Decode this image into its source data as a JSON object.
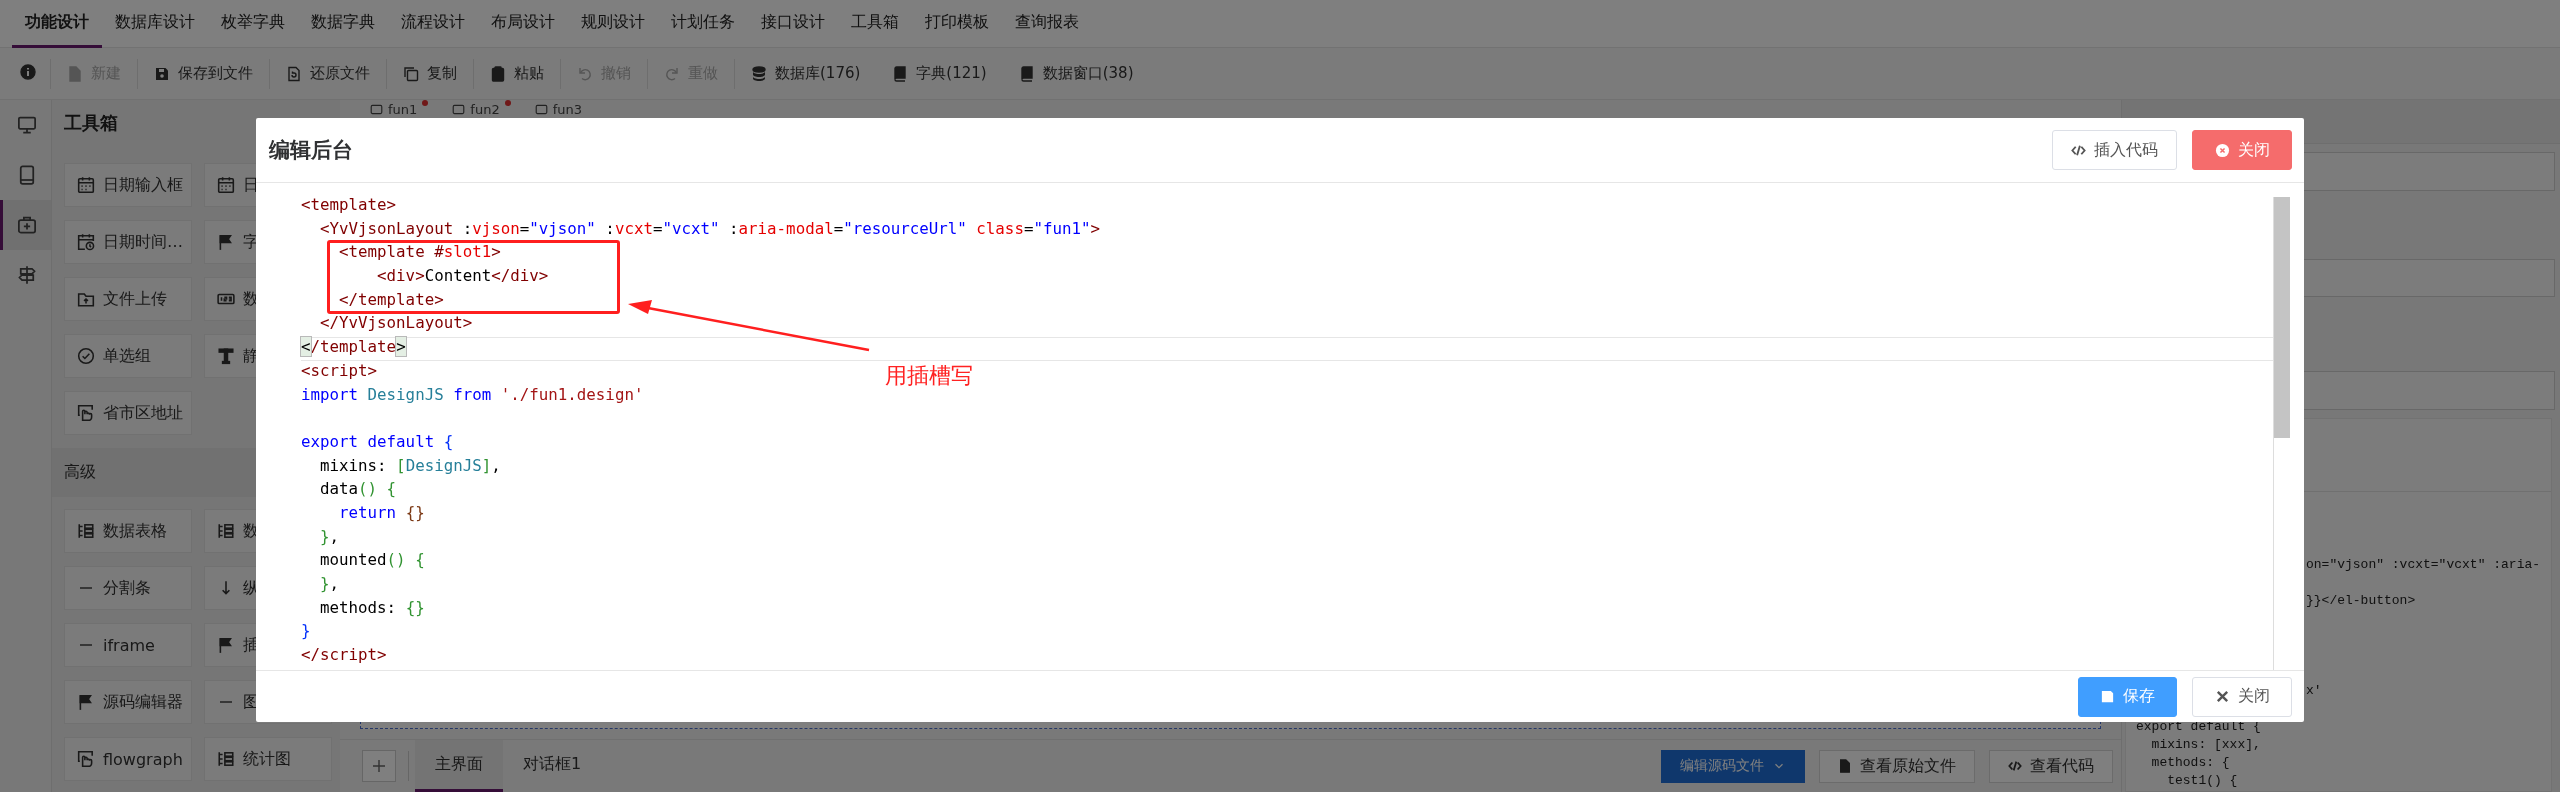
{
  "menu": [
    {
      "label": "功能设计",
      "selected": true
    },
    {
      "label": "数据库设计",
      "selected": false
    },
    {
      "label": "枚举字典",
      "selected": false
    },
    {
      "label": "数据字典",
      "selected": false
    },
    {
      "label": "流程设计",
      "selected": false
    },
    {
      "label": "布局设计",
      "selected": false
    },
    {
      "label": "规则设计",
      "selected": false
    },
    {
      "label": "计划任务",
      "selected": false
    },
    {
      "label": "接口设计",
      "selected": false
    },
    {
      "label": "工具箱",
      "selected": false
    },
    {
      "label": "打印模板",
      "selected": false
    },
    {
      "label": "查询报表",
      "selected": false
    }
  ],
  "toolbar": [
    {
      "label": "新建",
      "disabled": true
    },
    {
      "label": "保存到文件",
      "disabled": false
    },
    {
      "label": "还原文件",
      "disabled": false
    },
    {
      "label": "复制",
      "disabled": false
    },
    {
      "label": "粘贴",
      "disabled": false
    },
    {
      "label": "撤销",
      "disabled": true
    },
    {
      "label": "重做",
      "disabled": true
    },
    {
      "label": "数据库(176)",
      "disabled": false
    },
    {
      "label": "字典(121)",
      "disabled": false
    },
    {
      "label": "数据窗口(38)",
      "disabled": false
    }
  ],
  "rail": [
    {
      "selected": false
    },
    {
      "selected": false
    },
    {
      "selected": true
    },
    {
      "selected": false
    }
  ],
  "toolbox": {
    "title": "工具箱",
    "groups": [
      {
        "items": [
          {
            "label": "日期输入框"
          },
          {
            "label": "日"
          },
          {
            "label": "日期时间…"
          },
          {
            "label": "字"
          },
          {
            "label": "文件上传"
          },
          {
            "label": "数"
          },
          {
            "label": "单选组"
          },
          {
            "label": "静"
          },
          {
            "label": "省市区地址"
          }
        ]
      },
      {
        "title": "高级",
        "items": [
          {
            "label": "数据表格"
          },
          {
            "label": "数"
          },
          {
            "label": "分割条"
          },
          {
            "label": "纵"
          },
          {
            "label": "iframe"
          },
          {
            "label": "插"
          },
          {
            "label": "源码编辑器"
          },
          {
            "label": "图"
          },
          {
            "label": "flowgraph"
          },
          {
            "label": "统计图"
          }
        ]
      }
    ]
  },
  "editor_tabs": [
    {
      "label": "fun1",
      "modified": true
    },
    {
      "label": "fun2",
      "modified": true
    },
    {
      "label": "fun3",
      "modified": false
    }
  ],
  "bottom_bar": {
    "tabs": [
      {
        "label": "主界面",
        "selected": true
      },
      {
        "label": "对话框1",
        "selected": false
      }
    ],
    "buttons": [
      {
        "label": "编辑源码文件",
        "kind": "primary"
      },
      {
        "label": "查看原始文件",
        "kind": "default"
      },
      {
        "label": "查看代码",
        "kind": "default"
      }
    ]
  },
  "code_preview": {
    "lines": [
      {
        "text": "on=\"vjson\" :vcxt=\"vcxt\" :aria-",
        "kind": "covered"
      },
      {
        "text": "}}</el-button>",
        "kind": "covered"
      },
      {
        "text": "x'",
        "kind": "covered"
      },
      {
        "text": "export default {",
        "kind": "full"
      },
      {
        "text": "  mixins: [xxx],",
        "kind": "full"
      },
      {
        "text": "  methods: {",
        "kind": "full"
      },
      {
        "text": "    test1() {",
        "kind": "full"
      }
    ]
  },
  "dialog": {
    "title": "编辑后台",
    "header_buttons": [
      {
        "label": "插入代码",
        "kind": "default"
      },
      {
        "label": "关闭",
        "kind": "danger"
      }
    ],
    "code_lines": [
      {
        "kind": "code",
        "current": false,
        "tokens": [
          {
            "text": "<template>",
            "kind": "tag"
          }
        ]
      },
      {
        "kind": "code",
        "current": false,
        "tokens": [
          {
            "text": "  <YvVjsonLayout ",
            "kind": "tag"
          },
          {
            "text": ":",
            "kind": "plain"
          },
          {
            "text": "vjson",
            "kind": "attr"
          },
          {
            "text": "=",
            "kind": "plain"
          },
          {
            "text": "\"vjson\"",
            "kind": "value"
          },
          {
            "text": " :",
            "kind": "plain"
          },
          {
            "text": "vcxt",
            "kind": "attr"
          },
          {
            "text": "=",
            "kind": "plain"
          },
          {
            "text": "\"vcxt\"",
            "kind": "value"
          },
          {
            "text": " :",
            "kind": "plain"
          },
          {
            "text": "aria-modal",
            "kind": "attr"
          },
          {
            "text": "=",
            "kind": "plain"
          },
          {
            "text": "\"resourceUrl\"",
            "kind": "value"
          },
          {
            "text": " class",
            "kind": "attr"
          },
          {
            "text": "=",
            "kind": "plain"
          },
          {
            "text": "\"fun1\"",
            "kind": "value"
          },
          {
            "text": ">",
            "kind": "tag"
          }
        ]
      },
      {
        "kind": "code",
        "current": false,
        "tokens": [
          {
            "text": "    <template #",
            "kind": "tag"
          },
          {
            "text": "slot1",
            "kind": "attr"
          },
          {
            "text": ">",
            "kind": "tag"
          }
        ]
      },
      {
        "kind": "code",
        "current": false,
        "tokens": [
          {
            "text": "        <div>",
            "kind": "tag"
          },
          {
            "text": "Content",
            "kind": "plain"
          },
          {
            "text": "</div>",
            "kind": "tag"
          }
        ]
      },
      {
        "kind": "code",
        "current": false,
        "tokens": [
          {
            "text": "    </template>",
            "kind": "tag"
          }
        ]
      },
      {
        "kind": "code",
        "current": false,
        "tokens": [
          {
            "text": "  </YvVjsonLayout>",
            "kind": "tag"
          }
        ]
      },
      {
        "kind": "code",
        "current": true,
        "tokens": [
          {
            "text": "<",
            "kind": "match"
          },
          {
            "text": "/template",
            "kind": "tag"
          },
          {
            "text": ">",
            "kind": "match"
          }
        ]
      },
      {
        "kind": "code",
        "current": false,
        "tokens": [
          {
            "text": "<script>",
            "kind": "tag"
          }
        ]
      },
      {
        "kind": "code",
        "current": false,
        "tokens": [
          {
            "text": "import ",
            "kind": "keyword"
          },
          {
            "text": "DesignJS ",
            "kind": "type"
          },
          {
            "text": "from ",
            "kind": "keyword"
          },
          {
            "text": "'./fun1.design'",
            "kind": "string"
          }
        ]
      },
      {
        "kind": "blank"
      },
      {
        "kind": "code",
        "current": false,
        "tokens": [
          {
            "text": "export default ",
            "kind": "keyword"
          },
          {
            "text": "{",
            "kind": "brace1"
          }
        ]
      },
      {
        "kind": "code",
        "current": false,
        "tokens": [
          {
            "text": "  mixins: ",
            "kind": "plain"
          },
          {
            "text": "[",
            "kind": "brace2"
          },
          {
            "text": "DesignJS",
            "kind": "type"
          },
          {
            "text": "]",
            "kind": "brace2"
          },
          {
            "text": ",",
            "kind": "plain"
          }
        ]
      },
      {
        "kind": "code",
        "current": false,
        "tokens": [
          {
            "text": "  data",
            "kind": "plain"
          },
          {
            "text": "() {",
            "kind": "brace2"
          }
        ]
      },
      {
        "kind": "code",
        "current": false,
        "tokens": [
          {
            "text": "    return ",
            "kind": "keyword"
          },
          {
            "text": "{}",
            "kind": "brace3"
          }
        ]
      },
      {
        "kind": "code",
        "current": false,
        "tokens": [
          {
            "text": "  }",
            "kind": "brace2"
          },
          {
            "text": ",",
            "kind": "plain"
          }
        ]
      },
      {
        "kind": "code",
        "current": false,
        "tokens": [
          {
            "text": "  mounted",
            "kind": "plain"
          },
          {
            "text": "() {",
            "kind": "brace2"
          }
        ]
      },
      {
        "kind": "code",
        "current": false,
        "tokens": [
          {
            "text": "  }",
            "kind": "brace2"
          },
          {
            "text": ",",
            "kind": "plain"
          }
        ]
      },
      {
        "kind": "code",
        "current": false,
        "tokens": [
          {
            "text": "  methods: ",
            "kind": "plain"
          },
          {
            "text": "{}",
            "kind": "brace2"
          }
        ]
      },
      {
        "kind": "code",
        "current": false,
        "tokens": [
          {
            "text": "}",
            "kind": "brace1"
          }
        ]
      },
      {
        "kind": "code",
        "current": false,
        "tokens": [
          {
            "text": "</script>",
            "kind": "tag"
          }
        ]
      }
    ],
    "annotation": {
      "label": "用插槽写"
    },
    "footer_buttons": [
      {
        "label": "保存",
        "kind": "primary"
      },
      {
        "label": "关闭",
        "kind": "default"
      }
    ]
  }
}
